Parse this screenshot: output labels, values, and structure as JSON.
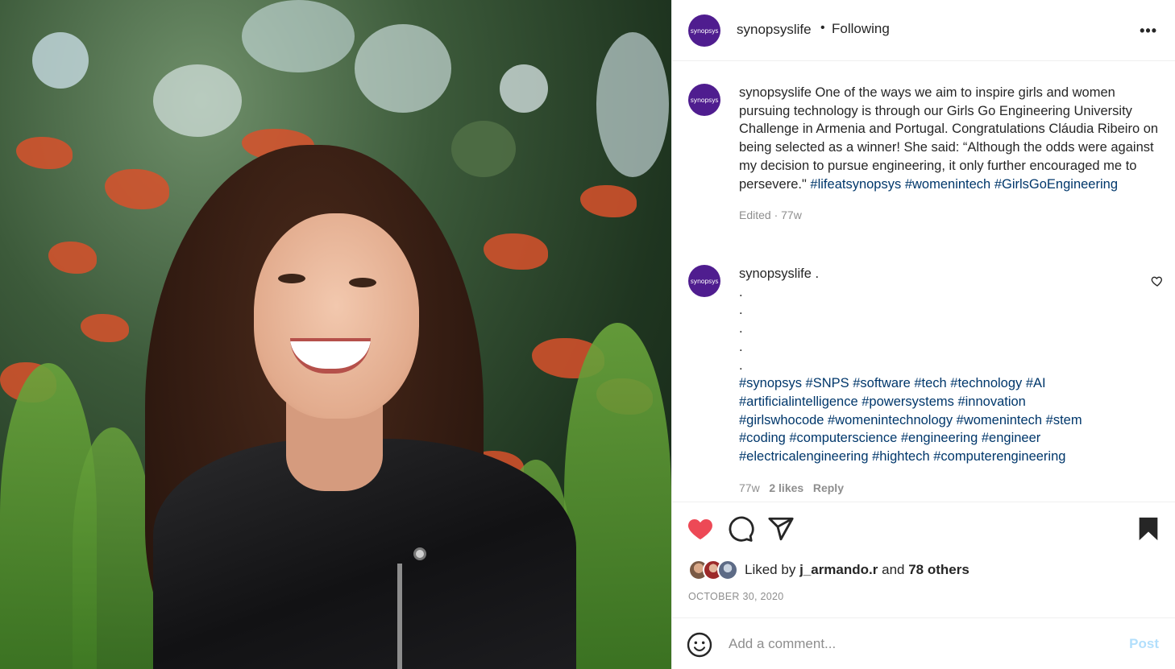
{
  "post": {
    "author": "synopsyslife",
    "avatar_text": "synopsys",
    "separator": "•",
    "follow_status": "Following",
    "more_icon": "more-dots-icon"
  },
  "caption": {
    "username": "synopsyslife",
    "text": "One of the ways we aim to inspire girls and women pursuing technology is through our Girls Go Engineering University Challenge in Armenia and Portugal. Congratulations Cláudia Ribeiro on being selected as a winner! She said: “Although the odds were against my decision to pursue engineering, it only further encouraged me to persevere.\"",
    "hashtags": [
      "#lifeatsynopsys",
      "#womenintech",
      "#GirlsGoEngineering"
    ],
    "meta": "Edited · 77w"
  },
  "comment": {
    "username": "synopsyslife",
    "first_line": ".",
    "dots": [
      ".",
      ".",
      ".",
      ".",
      "."
    ],
    "hashtags": "#synopsys #SNPS #software #tech #technology #AI #artificialintelligence #powersystems #innovation #girlswhocode #womenintechnology #womenintech #stem #coding #computerscience #engineering #engineer #electricalengineering #hightech #computerengineering",
    "time": "77w",
    "likes": "2 likes",
    "reply": "Reply"
  },
  "likes": {
    "prefix": "Liked by",
    "user": "j_armando.r",
    "and": "and",
    "others": "78 others"
  },
  "date": "OCTOBER 30, 2020",
  "add_comment": {
    "placeholder": "Add a comment...",
    "post_label": "Post"
  },
  "colors": {
    "brand_avatar": "#4f1d8f",
    "like_red": "#ed4956",
    "hashtag": "#00376b",
    "post_disabled": "#b2dffc"
  }
}
